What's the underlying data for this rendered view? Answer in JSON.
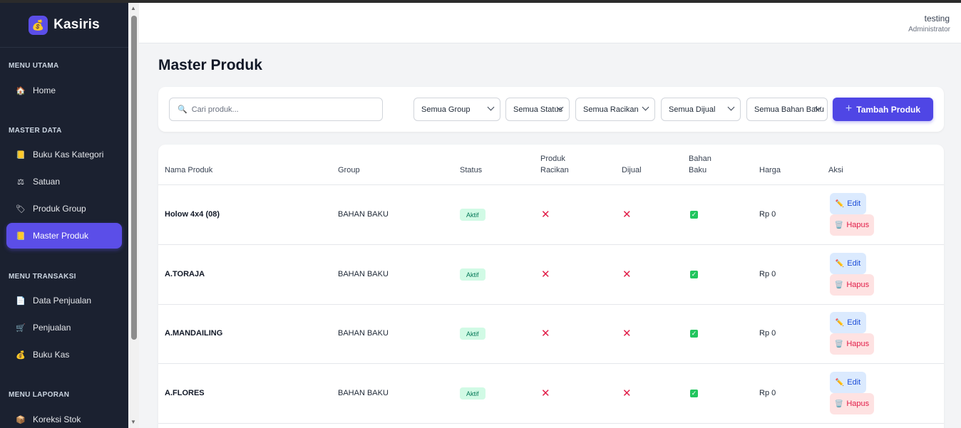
{
  "brand": {
    "name": "Kasiris",
    "logo_icon": "money-bag-icon"
  },
  "sidebar": {
    "sections": [
      {
        "title": "MENU UTAMA",
        "items": [
          {
            "label": "Home",
            "icon": "🏠"
          }
        ]
      },
      {
        "title": "MASTER DATA",
        "items": [
          {
            "label": "Buku Kas Kategori",
            "icon": "📒"
          },
          {
            "label": "Satuan",
            "icon": "⚖"
          },
          {
            "label": "Produk Group",
            "icon": "🏷"
          },
          {
            "label": "Master Produk",
            "icon": "📒",
            "active": true
          }
        ]
      },
      {
        "title": "MENU TRANSAKSI",
        "items": [
          {
            "label": "Data Penjualan",
            "icon": "📄"
          },
          {
            "label": "Penjualan",
            "icon": "🛒"
          },
          {
            "label": "Buku Kas",
            "icon": "💰"
          }
        ]
      },
      {
        "title": "MENU LAPORAN",
        "items": [
          {
            "label": "Koreksi Stok",
            "icon": "📦"
          }
        ]
      }
    ]
  },
  "header": {
    "user_name": "testing",
    "user_role": "Administrator"
  },
  "page": {
    "title": "Master Produk"
  },
  "filters": {
    "search_placeholder": "Cari produk...",
    "group": "Semua Group",
    "status": "Semua Status",
    "racikan": "Semua Racikan",
    "dijual": "Semua Dijual",
    "bahan_baku": "Semua Bahan Baku",
    "add_button": "Tambah Produk"
  },
  "table": {
    "headers": {
      "nama": "Nama Produk",
      "group": "Group",
      "status": "Status",
      "racikan_1": "Produk",
      "racikan_2": "Racikan",
      "dijual": "Dijual",
      "bahan_1": "Bahan",
      "bahan_2": "Baku",
      "harga": "Harga",
      "aksi": "Aksi"
    },
    "rows": [
      {
        "nama": "Holow 4x4 (08)",
        "group": "BAHAN BAKU",
        "status": "Aktif",
        "racikan": false,
        "dijual": false,
        "bahan_baku": true,
        "harga": "Rp 0"
      },
      {
        "nama": "A.TORAJA",
        "group": "BAHAN BAKU",
        "status": "Aktif",
        "racikan": false,
        "dijual": false,
        "bahan_baku": true,
        "harga": "Rp 0"
      },
      {
        "nama": "A.MANDAILING",
        "group": "BAHAN BAKU",
        "status": "Aktif",
        "racikan": false,
        "dijual": false,
        "bahan_baku": true,
        "harga": "Rp 0"
      },
      {
        "nama": "A.FLORES",
        "group": "BAHAN BAKU",
        "status": "Aktif",
        "racikan": false,
        "dijual": false,
        "bahan_baku": true,
        "harga": "Rp 0"
      }
    ],
    "edit_label": "Edit",
    "hapus_label": "Hapus"
  },
  "colors": {
    "accent": "#4f46e5",
    "sidebar_bg": "#1b2130",
    "success": "#22c55e",
    "danger": "#e11d48"
  }
}
